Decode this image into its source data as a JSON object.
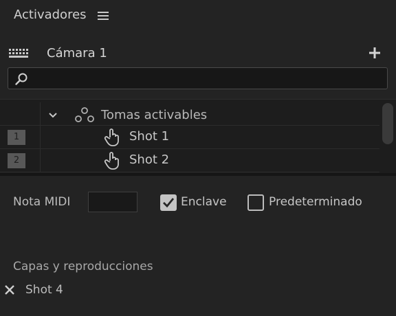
{
  "header": {
    "title": "Activadores",
    "menu_icon": "hamburger-menu-icon"
  },
  "camera": {
    "label": "Cámara 1",
    "keyboard_icon": "keyboard-icon",
    "add_icon": "plus-icon"
  },
  "search": {
    "value": "",
    "placeholder": "",
    "icon": "search-icon"
  },
  "tree": {
    "group": {
      "label": "Tomas activables",
      "icon": "group-circles-icon",
      "expand_icon": "chevron-down-icon"
    },
    "items": [
      {
        "number": "1",
        "label": "Shot 1",
        "icon": "hand-pointer-icon"
      },
      {
        "number": "2",
        "label": "Shot 2",
        "icon": "hand-pointer-icon"
      }
    ]
  },
  "settings": {
    "midi_label": "Nota MIDI",
    "midi_value": "",
    "latch_label": "Enclave",
    "latch_checked": true,
    "default_label": "Predeterminado",
    "default_checked": false
  },
  "layers": {
    "title": "Capas y reproducciones",
    "items": [
      {
        "label": "Shot 4",
        "remove_icon": "x-icon"
      }
    ]
  },
  "colors": {
    "background": "#232323",
    "tree_background": "#1d1d1d",
    "number_box": "#585858",
    "checkbox_checked": "#c4c4c4"
  }
}
